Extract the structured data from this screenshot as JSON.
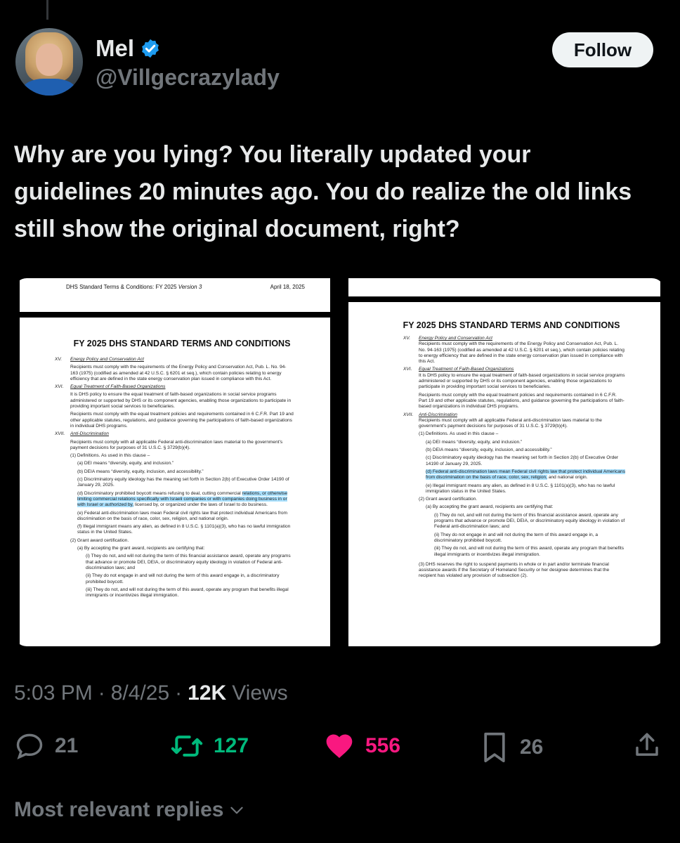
{
  "author": {
    "name": "Mel",
    "handle": "@Villgecrazylady",
    "verified": true,
    "avatar_icon": "profile-photo"
  },
  "follow_label": "Follow",
  "tweet": {
    "text": "Why are you lying? You literally updated your guidelines 20 minutes ago. You do realize the old links still show the original document, right?"
  },
  "media": {
    "left": {
      "header_left": "DHS Standard Terms & Conditions: FY 2025",
      "header_version": "Version 3",
      "header_date": "April 18, 2025",
      "title": "FY 2025 DHS STANDARD TERMS AND CONDITIONS",
      "sections": [
        {
          "num": "XV.",
          "title": "Energy Policy and Conservation Act",
          "body": "Recipients must comply with the requirements of the Energy Policy and Conservation Act, Pub. L. No. 94-163 (1975) (codified as amended at 42 U.S.C. § 6201 et seq.), which contain policies relating to energy efficiency that are defined in the state energy conservation plan issued in compliance with this Act."
        },
        {
          "num": "XVI.",
          "title": "Equal Treatment of Faith-Based Organizations",
          "body": "It is DHS policy to ensure the equal treatment of faith-based organizations in social service programs administered or supported by DHS or its component agencies, enabling those organizations to participate in providing important social services to beneficiaries.",
          "body2": "Recipients must comply with the equal treatment policies and requirements contained in 6 C.F.R. Part 19 and other applicable statutes, regulations, and guidance governing the participations of faith-based organizations in individual DHS programs."
        },
        {
          "num": "XVII.",
          "title": "Anti-Discrimination",
          "body": "Recipients must comply with all applicable Federal anti-discrimination laws material to the government's payment decisions for purposes of 31 U.S.C. § 3729(b)(4)."
        }
      ],
      "defs_intro": "(1) Definitions. As used in this clause –",
      "def_a": "(a) DEI means “diversity, equity, and inclusion.”",
      "def_b": "(b) DEIA means “diversity, equity, inclusion, and accessibility.”",
      "def_c": "(c) Discriminatory equity ideology has the meaning set forth in Section 2(b) of Executive Order 14190 of January 29, 2025.",
      "def_d_pre": "(d) Discriminatory prohibited boycott means refusing to deal, cutting commercial ",
      "def_d_hl": "relations, or otherwise limiting commercial relations specifically with Israeli companies or with companies doing business in or with Israel or authorized by,",
      "def_d_post": " licensed by, or organized under the laws of Israel to do business.",
      "def_e": "(e) Federal anti-discrimination laws mean Federal civil rights law that protect individual Americans from discrimination on the basis of race, color, sex, religion, and national origin.",
      "def_f": "(f) Illegal immigrant means any alien, as defined in 8 U.S.C. § 1101(a)(3), who has no lawful immigration status in the United States.",
      "cert_intro": "(2) Grant award certification.",
      "cert_a": "(a) By accepting the grant award, recipients are certifying that:",
      "cert_i": "(i) They do not, and will not during the term of this financial assistance award, operate any programs that advance or promote DEI, DEIA, or discriminatory equity ideology in violation of Federal anti-discrimination laws; and",
      "cert_ii": "(ii) They do not engage in and will not during the term of this award engage in, a discriminatory prohibited boycott.",
      "cert_iii": "(iii) They do not, and will not during the term of this award, operate any program that benefits illegal immigrants or incentivizes illegal immigration."
    },
    "right": {
      "title": "FY 2025 DHS STANDARD TERMS AND CONDITIONS",
      "sections": [
        {
          "num": "XV.",
          "title": "Energy Policy and Conservation Act",
          "body": "Recipients must comply with the requirements of the Energy Policy and Conservation Act, Pub. L. No. 94-163 (1975) (codified as amended at 42 U.S.C. § 6201 et seq.), which contain policies relating to energy efficiency that are defined in the state energy conservation plan issued in compliance with this Act."
        },
        {
          "num": "XVI.",
          "title": "Equal Treatment of Faith-Based Organizations",
          "body": "It is DHS policy to ensure the equal treatment of faith-based organizations in social service programs administered or supported by DHS or its component agencies, enabling those organizations to participate in providing important social services to beneficiaries.",
          "body2": "Recipients must comply with the equal treatment policies and requirements contained in 6 C.F.R. Part 19 and other applicable statutes, regulations, and guidance governing the participations of faith-based organizations in individual DHS programs."
        },
        {
          "num": "XVII.",
          "title": "Anti-Discrimination",
          "body": "Recipients must comply with all applicable Federal anti-discrimination laws material to the government's payment decisions for purposes of 31 U.S.C. § 3729(b)(4)."
        }
      ],
      "defs_intro": "(1) Definitions. As used in this clause –",
      "def_a": "(a) DEI means “diversity, equity, and inclusion.”",
      "def_b": "(b) DEIA means “diversity, equity, inclusion, and accessibility.”",
      "def_c": "(c) Discriminatory equity ideology has the meaning set forth in Section 2(b) of Executive Order 14190 of January 29, 2025.",
      "def_d_hl": "(d) Federal anti-discrimination laws mean Federal civil rights law that protect individual Americans from discrimination on the basis of race, color, sex, religion,",
      "def_d_post": " and national origin.",
      "def_e": "(e) Illegal immigrant means any alien, as defined in 8 U.S.C. § 1101(a)(3), who has no lawful immigration status in the United States.",
      "cert_intro": "(2) Grant award certification.",
      "cert_a": "(a) By accepting the grant award, recipients are certifying that:",
      "cert_i": "(i) They do not, and will not during the term of this financial assistance award, operate any programs that advance or promote DEI, DEIA, or discriminatory equity ideology in violation of Federal anti-discrimination laws; and",
      "cert_ii": "(ii) They do not engage in and will not during the term of this award engage in, a discriminatory prohibited boycott.",
      "cert_iii": "(iii) They do not, and will not during the term of this award, operate any program that benefits illegal immigrants or incentivizes illegal immigration.",
      "para3": "(3) DHS reserves the right to suspend payments in whole or in part and/or terminate financial assistance awards if the Secretary of Homeland Security or her designee determines that the recipient has violated any provision of subsection (2)."
    }
  },
  "meta": {
    "time": "5:03 PM",
    "date": "8/4/25",
    "views_count": "12K",
    "views_label": "Views"
  },
  "actions": {
    "replies": "21",
    "reposts": "127",
    "likes": "556",
    "bookmarks": "26"
  },
  "colors": {
    "repost": "#00ba7c",
    "like": "#f91880",
    "verified": "#1d9bf0",
    "muted": "#71767b"
  },
  "replies_sort_label": "Most relevant replies"
}
